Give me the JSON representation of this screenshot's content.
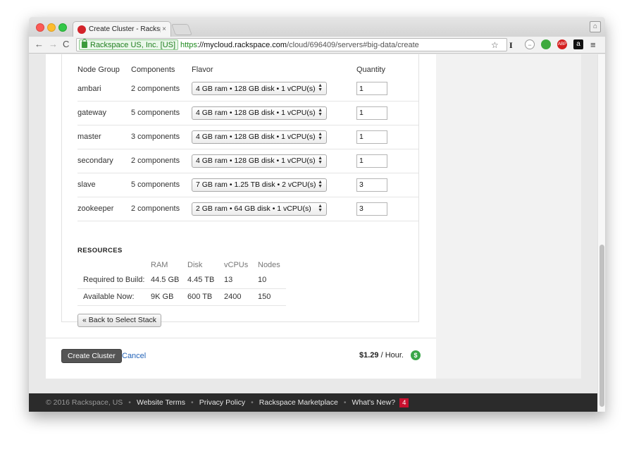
{
  "browser": {
    "tab_title": "Create Cluster - Rackspac",
    "tab_close": "×",
    "ev_org": "Rackspace US, Inc. [US]",
    "url_scheme": "https",
    "url_host": "://mycloud.rackspace.com",
    "url_path": "/cloud/696409/servers#big-data/create"
  },
  "node_groups": {
    "headers": [
      "Node Group",
      "Components",
      "Flavor",
      "Quantity"
    ],
    "rows": [
      {
        "name": "ambari",
        "components": "2 components",
        "flavor": "4 GB ram • 128 GB disk • 1 vCPU(s)",
        "quantity": "1"
      },
      {
        "name": "gateway",
        "components": "5 components",
        "flavor": "4 GB ram • 128 GB disk • 1 vCPU(s)",
        "quantity": "1"
      },
      {
        "name": "master",
        "components": "3 components",
        "flavor": "4 GB ram • 128 GB disk • 1 vCPU(s)",
        "quantity": "1"
      },
      {
        "name": "secondary",
        "components": "2 components",
        "flavor": "4 GB ram • 128 GB disk • 1 vCPU(s)",
        "quantity": "1"
      },
      {
        "name": "slave",
        "components": "5 components",
        "flavor": "7 GB ram • 1.25 TB disk • 2 vCPU(s)",
        "quantity": "3"
      },
      {
        "name": "zookeeper",
        "components": "2 components",
        "flavor": "2 GB ram • 64 GB disk • 1 vCPU(s)",
        "quantity": "3"
      }
    ]
  },
  "resources": {
    "title": "RESOURCES",
    "headers": [
      "RAM",
      "Disk",
      "vCPUs",
      "Nodes"
    ],
    "required": {
      "label": "Required to Build:",
      "ram": "44.5 GB",
      "disk": "4.45 TB",
      "vcpus": "13",
      "nodes": "10"
    },
    "available": {
      "label": "Available Now:",
      "ram": "9K GB",
      "disk": "600 TB",
      "vcpus": "2400",
      "nodes": "150"
    }
  },
  "actions": {
    "back": "« Back to Select Stack",
    "create": "Create Cluster",
    "cancel": "Cancel",
    "price_value": "$1.29",
    "price_unit": " / Hour."
  },
  "footer": {
    "copyright": "© 2016 Rackspace, US",
    "links": [
      "Website Terms",
      "Privacy Policy",
      "Rackspace Marketplace",
      "What's New?"
    ],
    "whats_new_count": "4",
    "separator": "•"
  }
}
